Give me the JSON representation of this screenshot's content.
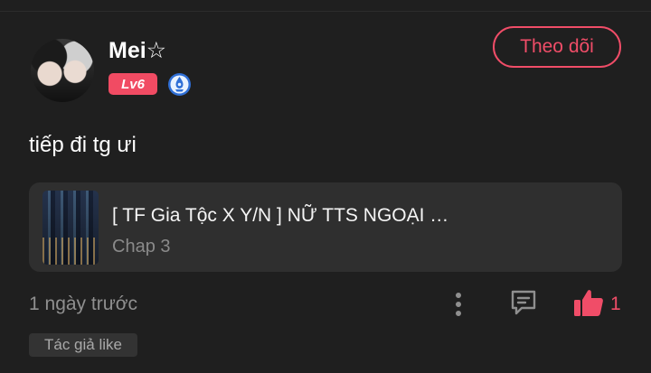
{
  "comment": {
    "user": {
      "name": "Mei☆",
      "level": "Lv6"
    },
    "follow_label": "Theo dõi",
    "text": "tiếp đi tg ưi",
    "story": {
      "title": "[ TF Gia Tộc X Y/N ] NỮ TTS NGOẠI …",
      "chapter": "Chap 3"
    },
    "time": "1 ngày trước",
    "like_count": "1",
    "author_like": "Tác giả like"
  },
  "colors": {
    "background": "#1f1f1f",
    "card": "#2f2f2f",
    "accent": "#f04d68",
    "muted_text": "#8f8f8f"
  },
  "icons": {
    "badge": "medal-icon",
    "more": "more-vertical-icon",
    "reply": "reply-icon",
    "like": "thumbs-up-icon"
  }
}
